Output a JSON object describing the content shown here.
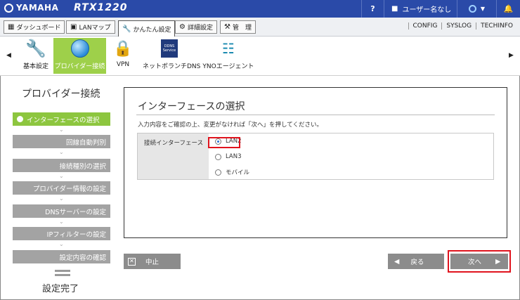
{
  "header": {
    "brand": "YAMAHA",
    "model": "RTX1220",
    "help": "?",
    "user": "ユーザー名なし",
    "status_caret": "▼",
    "bell": "🔔"
  },
  "tabs": [
    {
      "label": "ダッシュボード",
      "icon": "dashboard-icon"
    },
    {
      "label": "LANマップ",
      "icon": "lan-map-icon"
    },
    {
      "label": "かんたん設定",
      "icon": "wrench-icon"
    },
    {
      "label": "詳細設定",
      "icon": "gear-icon"
    },
    {
      "label": "管　理",
      "icon": "tools-icon"
    }
  ],
  "top_links": [
    "CONFIG",
    "SYSLOG",
    "TECHINFO"
  ],
  "menu": {
    "prev": "◀",
    "next": "▶",
    "items": [
      {
        "label": "基本設定"
      },
      {
        "label": "プロバイダー接続"
      },
      {
        "label": "VPN"
      },
      {
        "label": "ネットボランチDNS",
        "badge": "DDNS Service"
      },
      {
        "label": "YNOエージェント"
      }
    ]
  },
  "sidebar": {
    "title": "プロバイダー接続",
    "steps": [
      "インターフェースの選択",
      "回線自動判別",
      "接続種別の選択",
      "プロバイダー情報の設定",
      "DNSサーバーの設定",
      "IPフィルターの設定",
      "設定内容の確認"
    ],
    "chevron": "⌄",
    "done": "設定完了"
  },
  "main": {
    "title": "インターフェースの選択",
    "description": "入力内容をご確認の上、変更がなければ「次へ」を押してください。",
    "field_label": "接続インターフェース",
    "options": [
      "LAN2",
      "LAN3",
      "モバイル"
    ],
    "selected": "LAN2"
  },
  "buttons": {
    "cancel": "中止",
    "back": "戻る",
    "next": "次へ",
    "back_arrow": "◀",
    "next_arrow": "▶"
  },
  "colors": {
    "header": "#2a4aa8",
    "active_step": "#8dc63f",
    "step": "#a3a3a3",
    "button": "#8c8c8c",
    "highlight": "#e0141e"
  }
}
